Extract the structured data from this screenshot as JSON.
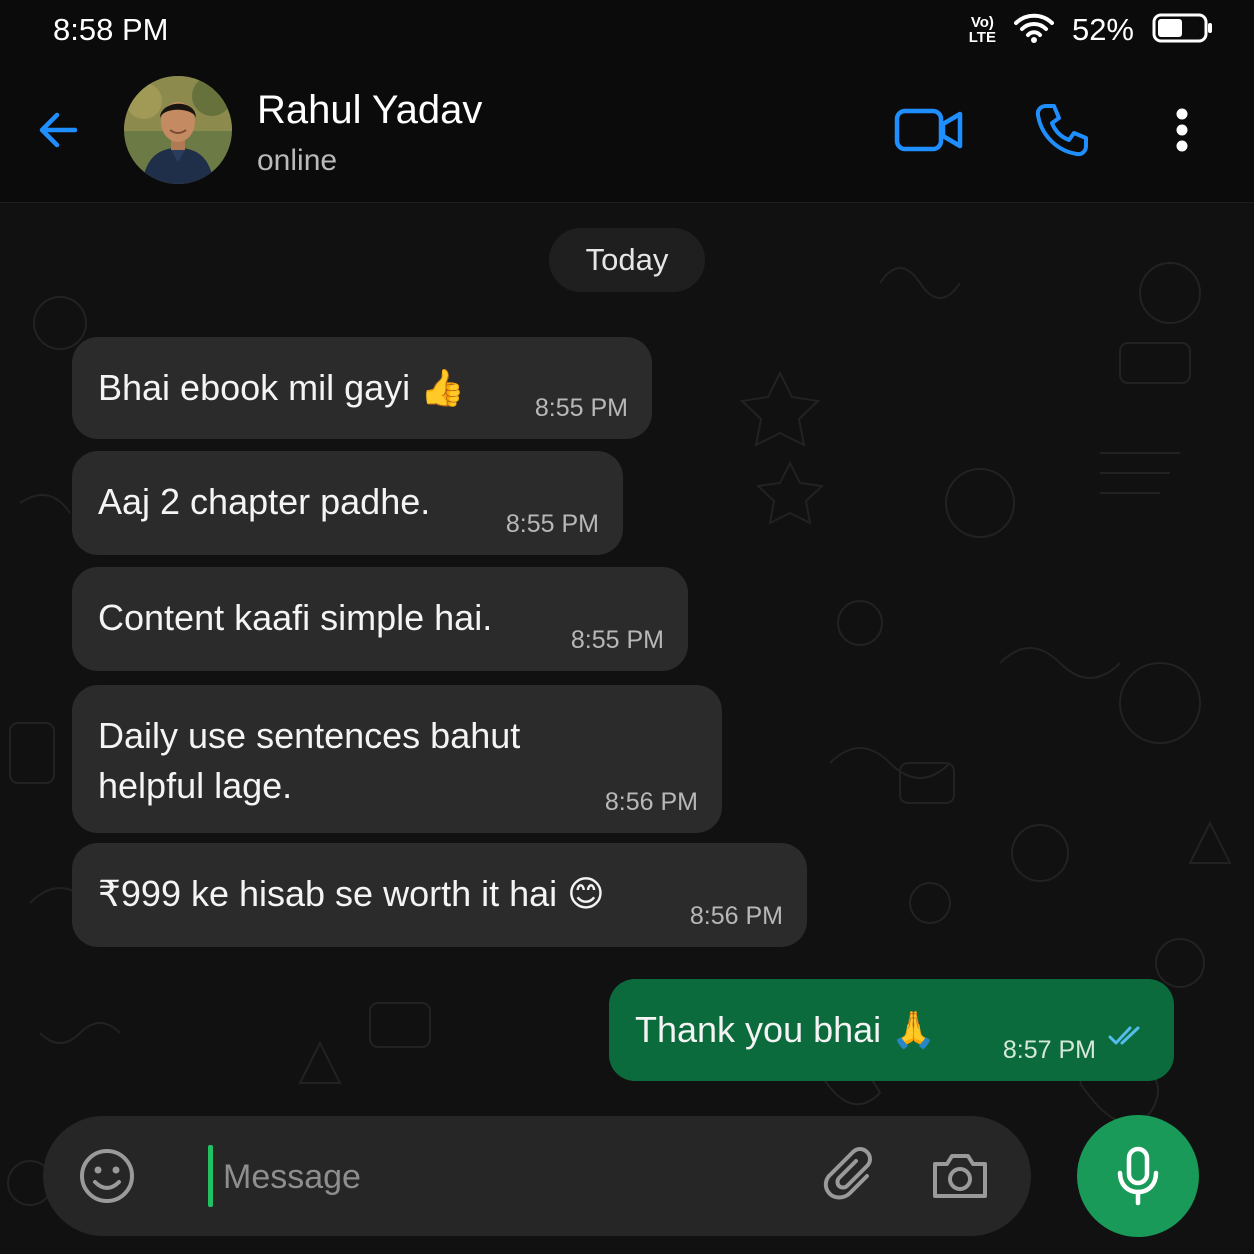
{
  "status_bar": {
    "time": "8:58 PM",
    "volte_top": "Vo)",
    "volte_bottom": "LTE",
    "battery_percent": "52%"
  },
  "header": {
    "contact_name": "Rahul Yadav",
    "contact_status": "online",
    "icons": [
      "back-arrow-icon",
      "video-call-icon",
      "phone-call-icon",
      "more-options-icon"
    ]
  },
  "chat": {
    "date_separator": "Today",
    "messages": [
      {
        "direction": "incoming",
        "text": "Bhai ebook mil gayi 👍",
        "time": "8:55 PM"
      },
      {
        "direction": "incoming",
        "text": "Aaj 2 chapter padhe.",
        "time": "8:55 PM"
      },
      {
        "direction": "incoming",
        "text": "Content kaafi simple hai.",
        "time": "8:55 PM"
      },
      {
        "direction": "incoming",
        "text": "Daily use sentences bahut helpful lage.",
        "time": "8:56 PM"
      },
      {
        "direction": "incoming",
        "text": "₹999 ke hisab se worth it hai 😊",
        "time": "8:56 PM"
      },
      {
        "direction": "outgoing",
        "text": "Thank you bhai 🙏",
        "time": "8:57 PM",
        "status": "read"
      }
    ]
  },
  "composer": {
    "placeholder": "Message",
    "value": ""
  },
  "colors": {
    "background": "#0b0b0b",
    "incoming_bubble": "#2b2b2b",
    "outgoing_bubble": "#0c6b3c",
    "accent_blue": "#1f8fff",
    "accent_green": "#1a9a58",
    "read_ticks": "#53bdeb"
  }
}
